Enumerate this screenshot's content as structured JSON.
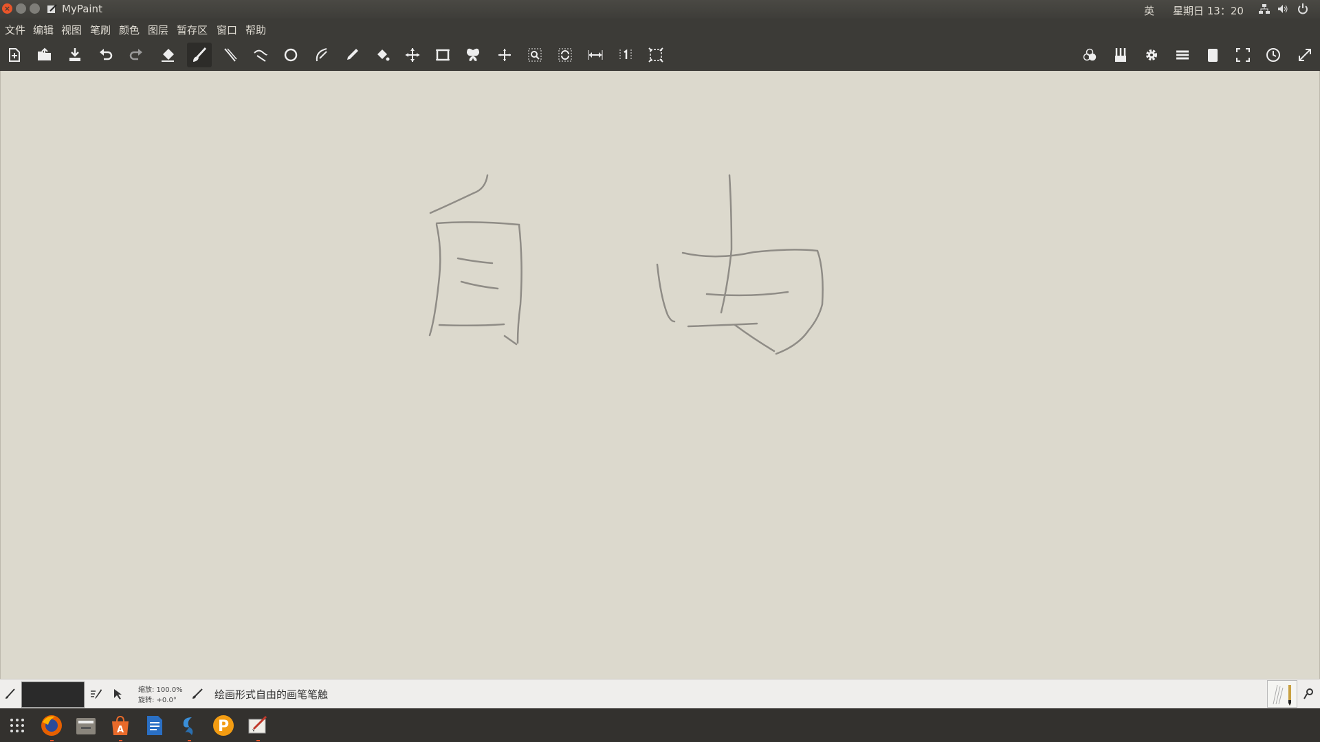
{
  "window": {
    "title": "MyPaint"
  },
  "system": {
    "input_method": "英",
    "clock": "星期日 13：20"
  },
  "menu": {
    "items": [
      "文件",
      "编辑",
      "视图",
      "笔刷",
      "颜色",
      "图层",
      "暂存区",
      "窗口",
      "帮助"
    ]
  },
  "toolbar": {
    "left_icons": [
      "new-document-icon",
      "open-file-icon",
      "save-icon",
      "undo-icon",
      "redo-icon",
      "eraser-icon",
      "brush-icon",
      "inking-icon",
      "freehand-line-icon",
      "ellipse-icon",
      "pen-curve-icon",
      "color-picker-icon",
      "fill-bucket-icon",
      "layer-move-icon",
      "frame-icon",
      "symmetry-icon",
      "pan-icon",
      "zoom-icon",
      "rotate-icon",
      "mirror-icon",
      "reset-zoom-icon",
      "fit-view-icon"
    ],
    "active_icon": "brush-icon",
    "right_icons": [
      "color-wheel-icon",
      "brushes-icon",
      "settings-icon",
      "layers-icon",
      "scratchpad-icon",
      "fullscreen-icon",
      "history-icon",
      "expand-icon"
    ]
  },
  "status": {
    "zoom": "缩放: 100.0%",
    "rotation": "旋转: +0.0°",
    "brush_description": "绘画形式自由的画笔笔触",
    "swatch_color": "#2a2a2a"
  },
  "dock": {
    "items": [
      "app-grid-icon",
      "firefox-icon",
      "files-icon",
      "software-center-icon",
      "text-editor-icon",
      "shotwell-icon",
      "p-app-icon",
      "mypaint-icon"
    ]
  },
  "colors": {
    "canvas": "#dcd9cd",
    "chrome": "#3c3b37",
    "accent": "#e9552a",
    "stroke": "#8f8c86"
  }
}
